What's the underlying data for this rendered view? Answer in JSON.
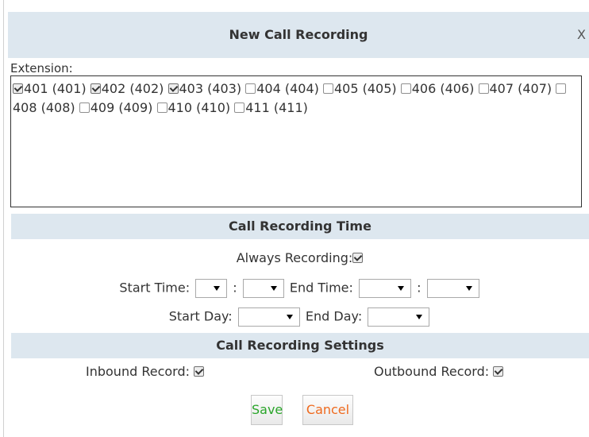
{
  "dialog": {
    "title": "New Call Recording",
    "close_label": "X"
  },
  "extension": {
    "label": "Extension:",
    "items": [
      {
        "label": "401 (401)",
        "checked": true
      },
      {
        "label": "402 (402)",
        "checked": true
      },
      {
        "label": "403 (403)",
        "checked": true
      },
      {
        "label": "404 (404)",
        "checked": false
      },
      {
        "label": "405 (405)",
        "checked": false
      },
      {
        "label": "406 (406)",
        "checked": false
      },
      {
        "label": "407 (407)",
        "checked": false
      },
      {
        "label": "408 (408)",
        "checked": false
      },
      {
        "label": "409 (409)",
        "checked": false
      },
      {
        "label": "410 (410)",
        "checked": false
      },
      {
        "label": "411 (411)",
        "checked": false
      }
    ]
  },
  "recording_time": {
    "heading": "Call Recording Time",
    "always_label": "Always Recording:",
    "always_checked": true,
    "start_time_label": "Start Time:",
    "end_time_label": "End Time:",
    "time_separator": ":",
    "start_day_label": "Start Day:",
    "end_day_label": "End Day:"
  },
  "settings": {
    "heading": "Call Recording Settings",
    "inbound_label": "Inbound Record:",
    "inbound_checked": true,
    "outbound_label": "Outbound Record:",
    "outbound_checked": true
  },
  "buttons": {
    "save_label": "Save",
    "cancel_label": "Cancel"
  },
  "colors": {
    "header_bg": "#dde7ef",
    "save_text": "#2aa52a",
    "cancel_text": "#ef6a1e"
  }
}
